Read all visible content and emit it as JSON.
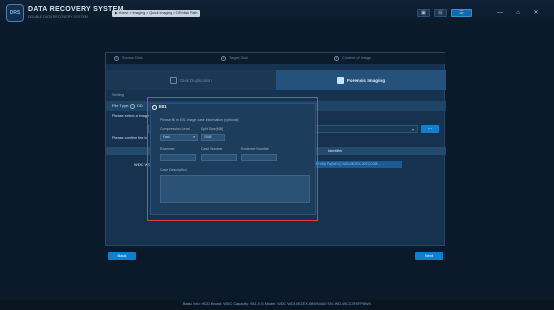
{
  "app": {
    "logo_text": "DRS",
    "title": "DATA RECOVERY SYSTEM",
    "subtitle": "DOUBLE DATA RECOVERY SYSTEM",
    "breadcrumb": "▶ Home > Imaging > Quick Imaging > DR/disk Path"
  },
  "toolbar": {
    "buttons": [
      "▣",
      "⊟",
      "☰"
    ],
    "window_controls": [
      "—",
      "⌂",
      "✕"
    ]
  },
  "wizard": {
    "steps": [
      {
        "num": "1",
        "label": "Source Disk"
      },
      {
        "num": "2",
        "label": "Target Disk"
      },
      {
        "num": "3",
        "label": "Content of Image"
      }
    ],
    "tabs": {
      "disk_duplication": "Disk Duplication",
      "forensic_imaging": "Forensic Imaging"
    },
    "setting_label": "Setting",
    "file_type_label": "File Type:",
    "file_type_options": [
      "DD",
      "E01"
    ],
    "select_image_label": "Please select a image",
    "path_dropdown_icon": "▾",
    "browse_label": "...",
    "location_label": "Please confirm the lo",
    "columns": {
      "identifier": "Identifier"
    },
    "disk": {
      "name": "WDC WC",
      "identifier": "PHISA Pa(WDC) WD10EZEX-00TCCGB..."
    }
  },
  "popup": {
    "e01_label": "E01",
    "heading": "Please fill in E01 image case information (optional)",
    "compression_label": "Compression Level",
    "compression_value": "Fast",
    "compression_arrow": "▾",
    "split_label": "Split Size(MB)",
    "split_value": "2048",
    "examiner_label": "Examiner",
    "case_number_label": "Case Number",
    "evidence_number_label": "Evidence Number",
    "case_description_label": "Case Description"
  },
  "nav": {
    "back": "Back",
    "next": "Next"
  },
  "status": {
    "text": "Basic Info:   HDD Brand: WDC   Capacity: 931.5 G   Model: WDC WD10EZEX-08WN4A0   SN:   WD-WCC3F6FP8WX"
  },
  "colors": {
    "accent": "#0f7fd0",
    "highlight": "#e23b3b",
    "background": "#0b1a2a"
  }
}
